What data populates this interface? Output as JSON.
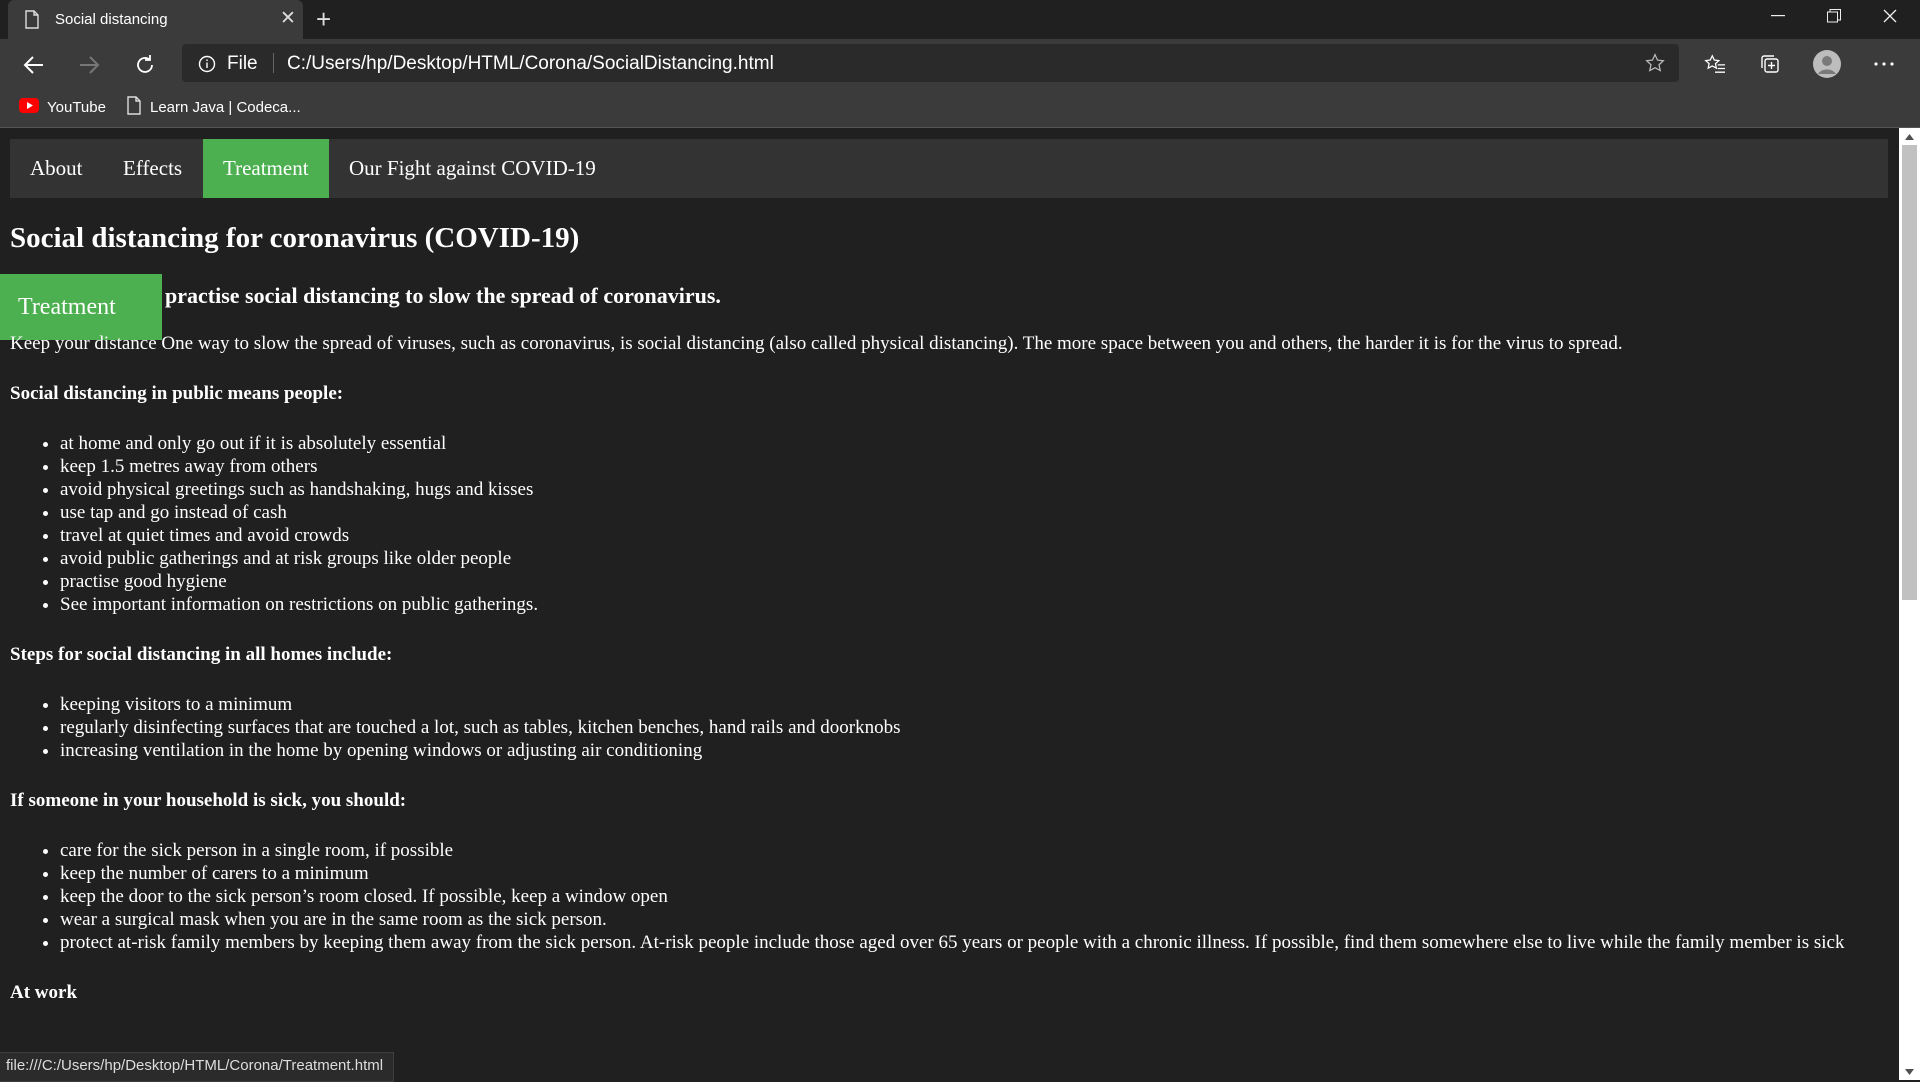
{
  "browser": {
    "tab_title": "Social distancing",
    "address_scheme": "File",
    "address_url": "C:/Users/hp/Desktop/HTML/Corona/SocialDistancing.html",
    "bookmarks": [
      {
        "label": "YouTube",
        "icon": "youtube-icon"
      },
      {
        "label": "Learn Java | Codeca...",
        "icon": "page-icon"
      }
    ],
    "status_url": "file:///C:/Users/hp/Desktop/HTML/Corona/Treatment.html"
  },
  "nav": {
    "items": [
      {
        "label": "About"
      },
      {
        "label": "Effects"
      },
      {
        "label": "Treatment",
        "active": true
      },
      {
        "label": "Our Fight against COVID-19"
      }
    ],
    "active_color": "#4caf50"
  },
  "page": {
    "title": "Social distancing for coronavirus (COVID-19)",
    "float_button": "Treatment",
    "subtitle": "practise social distancing to slow the spread of coronavirus.",
    "intro": "Keep your distance One way to slow the spread of viruses, such as coronavirus, is social distancing (also called physical distancing). The more space between you and others, the harder it is for the virus to spread.",
    "public": {
      "heading": "Social distancing in public means people:",
      "items": [
        "at home and only go out if it is absolutely essential",
        "keep 1.5 metres away from others",
        "avoid physical greetings such as handshaking, hugs and kisses",
        "use tap and go instead of cash",
        "travel at quiet times and avoid crowds",
        "avoid public gatherings and at risk groups like older people",
        "practise good hygiene",
        "See important information on restrictions on public gatherings."
      ]
    },
    "homes": {
      "heading": "Steps for social distancing in all homes include:",
      "items": [
        "keeping visitors to a minimum",
        "regularly disinfecting surfaces that are touched a lot, such as tables, kitchen benches, hand rails and doorknobs",
        "increasing ventilation in the home by opening windows or adjusting air conditioning"
      ]
    },
    "sick": {
      "heading": "If someone in your household is sick, you should:",
      "items": [
        "care for the sick person in a single room, if possible",
        "keep the number of carers to a minimum",
        "keep the door to the sick person’s room closed. If possible, keep a window open",
        "wear a surgical mask when you are in the same room as the sick person.",
        "protect at-risk family members by keeping them away from the sick person. At-risk people include those aged over 65 years or people with a chronic illness. If possible, find them somewhere else to live while the family member is sick"
      ]
    },
    "work_heading": "At work"
  }
}
